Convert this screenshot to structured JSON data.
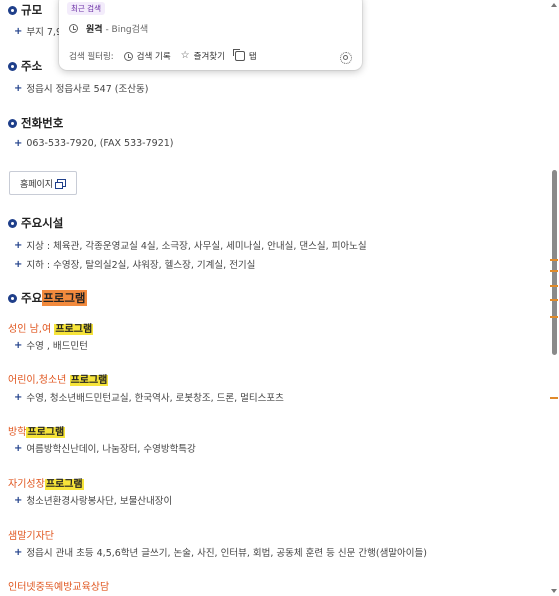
{
  "popup": {
    "recent_label": "최근 검색",
    "recent_item": "원격",
    "recent_sub": "- Bing검색",
    "filter_label": "검색 필터링:",
    "filters": [
      "검색 기록",
      "즐겨찾기",
      "탭"
    ]
  },
  "sections": {
    "scale": {
      "title": "규모",
      "line": "부지 7,90"
    },
    "address": {
      "title": "주소",
      "line": "정읍시 정읍사로 547 (조산동)"
    },
    "phone": {
      "title": "전화번호",
      "line": "063-533-7920, (FAX 533-7921)"
    },
    "homepage_button": "홈페이지",
    "facilities": {
      "title": "주요시설",
      "lines": [
        "지상 : 체육관, 각종운영교실 4실, 소극장, 사무실, 세미나실, 안내실, 댄스실, 피아노실",
        "지하 : 수영장, 탈의실2실, 샤워장, 헬스장, 기계실, 전기실"
      ]
    },
    "programs": {
      "title_prefix": "주요",
      "title_highlight": "프로그램",
      "groups": [
        {
          "title_prefix": "성인 남,여 ",
          "title_highlight": "프로그램",
          "line": "수영 , 배드민턴"
        },
        {
          "title_prefix": "어린이,청소년 ",
          "title_highlight": "프로그램",
          "line": "수영, 청소년배드민턴교실, 한국역사, 로봇창조, 드론, 멀티스포츠"
        },
        {
          "title_prefix": "방학",
          "title_highlight": "프로그램",
          "line": "여름방학신난데이, 나눔장터, 수영방학특강"
        },
        {
          "title_prefix": "자기성장",
          "title_highlight": "프로그램",
          "line": "청소년환경사랑봉사단, 보물산내장이"
        },
        {
          "title_prefix": "샘말기자단",
          "title_highlight": "",
          "line": "정읍시 관내 초등 4,5,6학년 글쓰기, 논술, 사진, 인터뷰, 회법, 공동체 훈련 등 신문 간행(샘말아이들)"
        },
        {
          "title_prefix": "인터넷중독예방교육상담",
          "title_highlight": "",
          "line": ""
        }
      ]
    }
  },
  "colors": {
    "accent_blue": "#1f3f8a",
    "sub_title_orange": "#e0561f",
    "highlight_yellow": "#f6e43a",
    "highlight_orange": "#f28a3d"
  }
}
